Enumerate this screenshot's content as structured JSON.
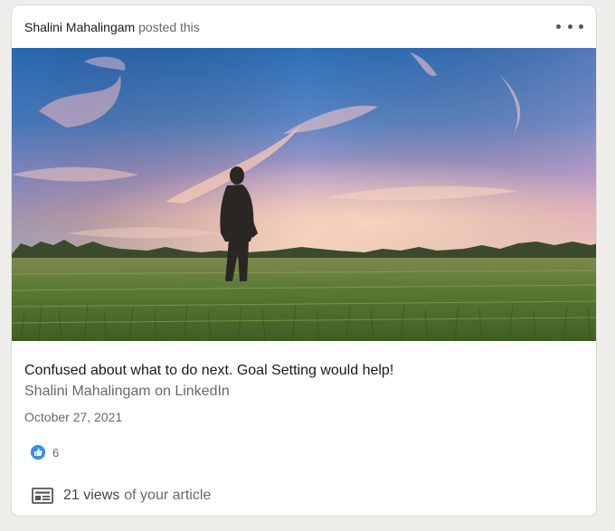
{
  "header": {
    "author_name": "Shalini Mahalingam",
    "action_text": "posted this",
    "more_icon": "more-horizontal-icon"
  },
  "article": {
    "image_description": "hero-photo",
    "title": "Confused about what to do next. Goal Setting would help!",
    "source": "Shalini Mahalingam on LinkedIn",
    "date": "October 27, 2021"
  },
  "reactions": {
    "icon": "like-icon",
    "count": "6"
  },
  "views": {
    "icon": "article-stats-icon",
    "count_label": "21 views",
    "suffix": "of your article"
  },
  "colors": {
    "card_bg": "#ffffff",
    "page_bg": "#efeeeb",
    "like_blue": "#378fe9",
    "like_blue_dark": "#0a66c2"
  }
}
